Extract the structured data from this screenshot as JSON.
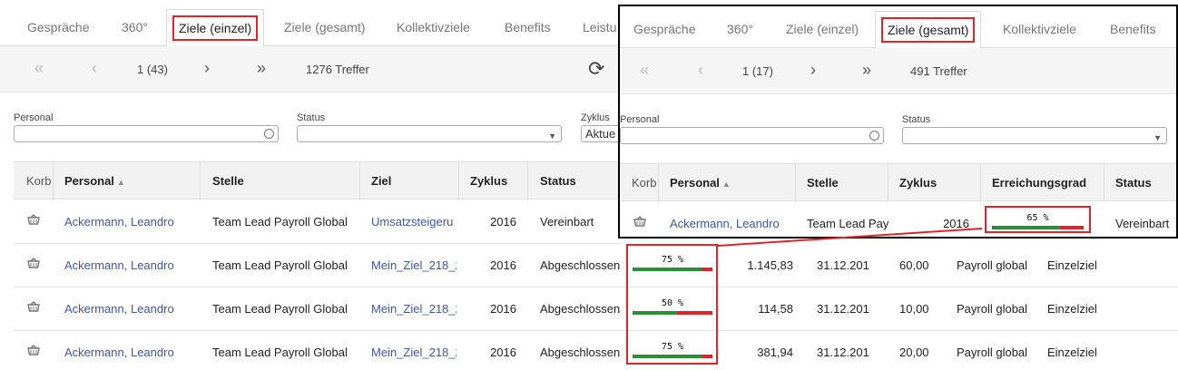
{
  "left": {
    "tabs": [
      "Gespräche",
      "360°",
      "Ziele (einzel)",
      "Ziele (gesamt)",
      "Kollektivziele",
      "Benefits",
      "Leistu"
    ],
    "pager": {
      "page": "1 (43)",
      "hits": "1276 Treffer"
    },
    "filters": {
      "personal_label": "Personal",
      "status_label": "Status",
      "zyklus_label": "Zyklus",
      "zyklus_value": "Aktue"
    },
    "columns": [
      "Korb",
      "Personal",
      "Stelle",
      "Ziel",
      "Zyklus",
      "Status"
    ],
    "rows": [
      {
        "personal": "Ackermann, Leandro",
        "stelle": "Team Lead Payroll Global",
        "ziel": "Umsatzsteigeru",
        "zyklus": "2016",
        "status": "Vereinbart"
      },
      {
        "personal": "Ackermann, Leandro",
        "stelle": "Team Lead Payroll Global",
        "ziel": "Mein_Ziel_218_2",
        "zyklus": "2016",
        "status": "Abgeschlossen"
      },
      {
        "personal": "Ackermann, Leandro",
        "stelle": "Team Lead Payroll Global",
        "ziel": "Mein_Ziel_218_2",
        "zyklus": "2016",
        "status": "Abgeschlossen"
      },
      {
        "personal": "Ackermann, Leandro",
        "stelle": "Team Lead Payroll Global",
        "ziel": "Mein_Ziel_218_2",
        "zyklus": "2016",
        "status": "Abgeschlossen"
      }
    ]
  },
  "extra_rows": [
    {
      "progress_label": "75 %",
      "progress": 0.86,
      "betrag": "1.145,83",
      "datum": "31.12.201",
      "wert": "60,00",
      "bereich": "Payroll global",
      "art": "Einzelziel"
    },
    {
      "progress_label": "50 %",
      "progress": 0.56,
      "betrag": "114,58",
      "datum": "31.12.201",
      "wert": "10,00",
      "bereich": "Payroll global",
      "art": "Einzelziel"
    },
    {
      "progress_label": "75 %",
      "progress": 0.86,
      "betrag": "381,94",
      "datum": "31.12.201",
      "wert": "20,00",
      "bereich": "Payroll global",
      "art": "Einzelziel"
    }
  ],
  "right": {
    "tabs": [
      "Gespräche",
      "360°",
      "Ziele (einzel)",
      "Ziele (gesamt)",
      "Kollektivziele",
      "Benefits"
    ],
    "pager": {
      "page": "1 (17)",
      "hits": "491 Treffer"
    },
    "filters": {
      "personal_label": "Personal",
      "status_label": "Status"
    },
    "columns": [
      "Korb",
      "Personal",
      "Stelle",
      "Zyklus",
      "Erreichungsgrad",
      "Status"
    ],
    "row": {
      "personal": "Ackermann, Leandro",
      "stelle": "Team Lead Pay",
      "zyklus": "2016",
      "progress_label": "65 %",
      "progress": 0.74,
      "status": "Vereinbart"
    }
  },
  "colors": {
    "accent_red": "#e3232a",
    "progress_green": "#2a8f3a",
    "link_blue": "#3f57a6"
  }
}
